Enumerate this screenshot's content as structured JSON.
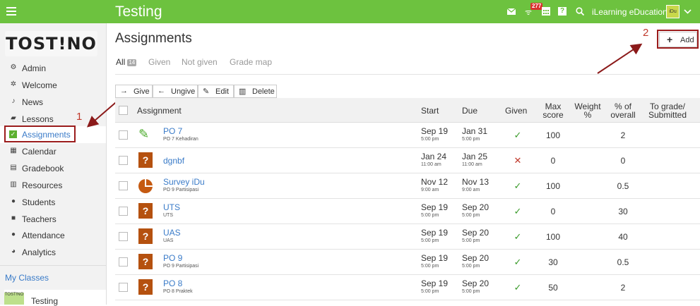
{
  "topbar": {
    "title": "Testing",
    "notifications_badge": "277",
    "user_name": "iLearning eDucation",
    "avatar_text": "iDu",
    "icons": [
      "mail-icon",
      "notifications-icon",
      "calendar-icon",
      "help-icon",
      "search-icon",
      "chevron-down-icon"
    ]
  },
  "sidebar": {
    "logo_text": "TOST!NO",
    "items": [
      {
        "label": "Admin",
        "icon": "gear-icon"
      },
      {
        "label": "Welcome",
        "icon": "sparkle-icon"
      },
      {
        "label": "News",
        "icon": "bell-icon"
      },
      {
        "label": "Lessons",
        "icon": "chat-icon"
      },
      {
        "label": "Assignments",
        "icon": "check-square-icon",
        "active": true
      },
      {
        "label": "Calendar",
        "icon": "calendar-grid-icon"
      },
      {
        "label": "Gradebook",
        "icon": "gradebook-icon"
      },
      {
        "label": "Resources",
        "icon": "resources-icon"
      },
      {
        "label": "Students",
        "icon": "person-icon"
      },
      {
        "label": "Teachers",
        "icon": "teacher-icon"
      },
      {
        "label": "Attendance",
        "icon": "group-icon"
      },
      {
        "label": "Analytics",
        "icon": "pie-chart-icon"
      }
    ],
    "my_classes_label": "My Classes",
    "class_item": {
      "name": "Testing",
      "thumb_text": "TOST!NO"
    }
  },
  "annotations": {
    "one": "1",
    "two": "2"
  },
  "main": {
    "page_title": "Assignments",
    "add_label": "Add",
    "tabs": [
      {
        "label": "All",
        "count": "14",
        "active": true
      },
      {
        "label": "Given"
      },
      {
        "label": "Not given"
      },
      {
        "label": "Grade map"
      }
    ],
    "actions": [
      {
        "label": "Give",
        "icon": "arrow-right-icon"
      },
      {
        "label": "Ungive",
        "icon": "arrow-left-icon"
      },
      {
        "label": "Edit",
        "icon": "pencil-icon"
      },
      {
        "label": "Delete",
        "icon": "trash-icon"
      }
    ],
    "columns": {
      "assignment": "Assignment",
      "start": "Start",
      "due": "Due",
      "given": "Given",
      "max_score_1": "Max",
      "max_score_2": "score",
      "weight_1": "Weight",
      "weight_2": "%",
      "overall_1": "% of",
      "overall_2": "overall",
      "tograde_1": "To grade/",
      "tograde_2": "Submitted"
    },
    "rows": [
      {
        "name": "PO 7",
        "sub": "PO 7 Kehadiran",
        "icon": "pencil-icon",
        "start": "Sep 19",
        "start_time": "5:00 pm",
        "due": "Jan 31",
        "due_time": "5:00 pm",
        "given": "yes",
        "given_mark": "✓",
        "max": "100",
        "weight": "",
        "overall": "2",
        "to_grade": ""
      },
      {
        "name": "dgnbf",
        "sub": "",
        "icon": "document-question-icon",
        "start": "Jan 24",
        "start_time": "11:00 am",
        "due": "Jan 25",
        "due_time": "11:00 am",
        "given": "no",
        "given_mark": "✕",
        "max": "0",
        "weight": "",
        "overall": "0",
        "to_grade": ""
      },
      {
        "name": "Survey iDu",
        "sub": "PO 9 Partisipasi",
        "icon": "survey-pie-icon",
        "start": "Nov 12",
        "start_time": "9:00 am",
        "due": "Nov 13",
        "due_time": "9:00 am",
        "given": "yes",
        "given_mark": "✓",
        "max": "100",
        "weight": "",
        "overall": "0.5",
        "to_grade": ""
      },
      {
        "name": "UTS",
        "sub": "UTS",
        "icon": "document-question-icon",
        "start": "Sep 19",
        "start_time": "5:00 pm",
        "due": "Sep 20",
        "due_time": "5:00 pm",
        "given": "yes",
        "given_mark": "✓",
        "max": "0",
        "weight": "",
        "overall": "30",
        "to_grade": ""
      },
      {
        "name": "UAS",
        "sub": "UAS",
        "icon": "document-question-icon",
        "start": "Sep 19",
        "start_time": "5:00 pm",
        "due": "Sep 20",
        "due_time": "5:00 pm",
        "given": "yes",
        "given_mark": "✓",
        "max": "100",
        "weight": "",
        "overall": "40",
        "to_grade": ""
      },
      {
        "name": "PO 9",
        "sub": "PO 9 Partisipasi",
        "icon": "document-question-icon",
        "start": "Sep 19",
        "start_time": "5:00 pm",
        "due": "Sep 20",
        "due_time": "5:00 pm",
        "given": "yes",
        "given_mark": "✓",
        "max": "30",
        "weight": "",
        "overall": "0.5",
        "to_grade": ""
      },
      {
        "name": "PO 8",
        "sub": "PO 8 Praktek",
        "icon": "document-question-icon",
        "start": "Sep 19",
        "start_time": "5:00 pm",
        "due": "Sep 20",
        "due_time": "5:00 pm",
        "given": "yes",
        "given_mark": "✓",
        "max": "50",
        "weight": "",
        "overall": "2",
        "to_grade": ""
      }
    ]
  }
}
